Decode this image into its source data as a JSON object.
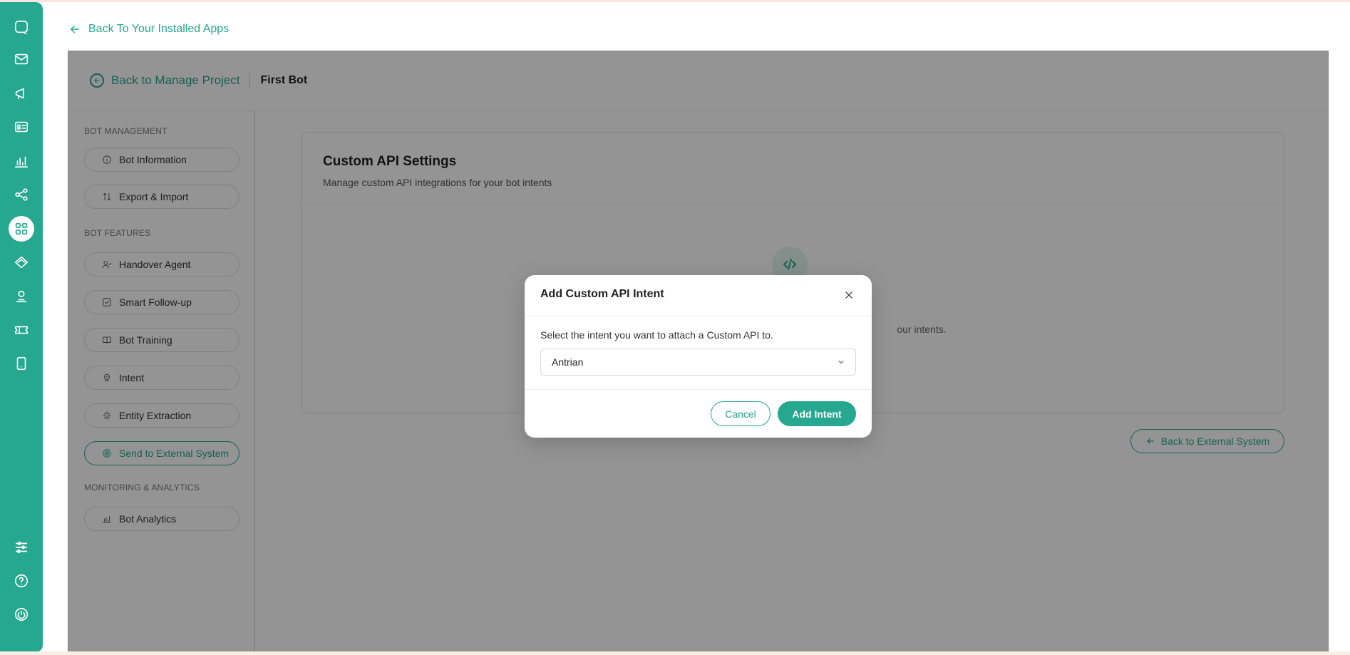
{
  "top_link": {
    "label": "Back To Your Installed Apps"
  },
  "header": {
    "back_label": "Back to Manage Project",
    "title": "First Bot"
  },
  "rail": {
    "icons": [
      "chat-icon",
      "mail-icon",
      "megaphone-icon",
      "contact-card-icon",
      "analytics-icon",
      "share-icon",
      "apps-grid-icon",
      "layers-icon",
      "agent-icon",
      "ticket-icon",
      "mobile-icon",
      "sliders-icon",
      "help-icon",
      "power-icon"
    ],
    "active": "apps-grid-icon"
  },
  "side_nav": {
    "sections": [
      {
        "title": "BOT MANAGEMENT",
        "items": [
          {
            "label": "Bot Information",
            "icon": "info-icon"
          },
          {
            "label": "Export & Import",
            "icon": "swap-icon"
          }
        ]
      },
      {
        "title": "BOT FEATURES",
        "items": [
          {
            "label": "Handover Agent",
            "icon": "user-check-icon"
          },
          {
            "label": "Smart Follow-up",
            "icon": "edit-check-icon"
          },
          {
            "label": "Bot Training",
            "icon": "book-icon"
          },
          {
            "label": "Intent",
            "icon": "brain-icon"
          },
          {
            "label": "Entity Extraction",
            "icon": "sparkle-icon"
          },
          {
            "label": "Send to External System",
            "icon": "target-icon",
            "active": true
          }
        ]
      },
      {
        "title": "MONITORING & ANALYTICS",
        "items": [
          {
            "label": "Bot Analytics",
            "icon": "bar-chart-icon"
          }
        ]
      }
    ]
  },
  "card": {
    "title": "Custom API Settings",
    "subtitle": "Manage custom API integrations for your bot intents",
    "empty_text_visible": "our intents."
  },
  "external_back": {
    "label": "Back to External System"
  },
  "modal": {
    "title": "Add Custom API Intent",
    "prompt": "Select the intent you want to attach a Custom API to.",
    "selected_intent": "Antrian",
    "cancel_label": "Cancel",
    "add_label": "Add Intent"
  },
  "colors": {
    "accent": "#26a78f",
    "overlay": "rgba(0,0,0,0.42)"
  }
}
